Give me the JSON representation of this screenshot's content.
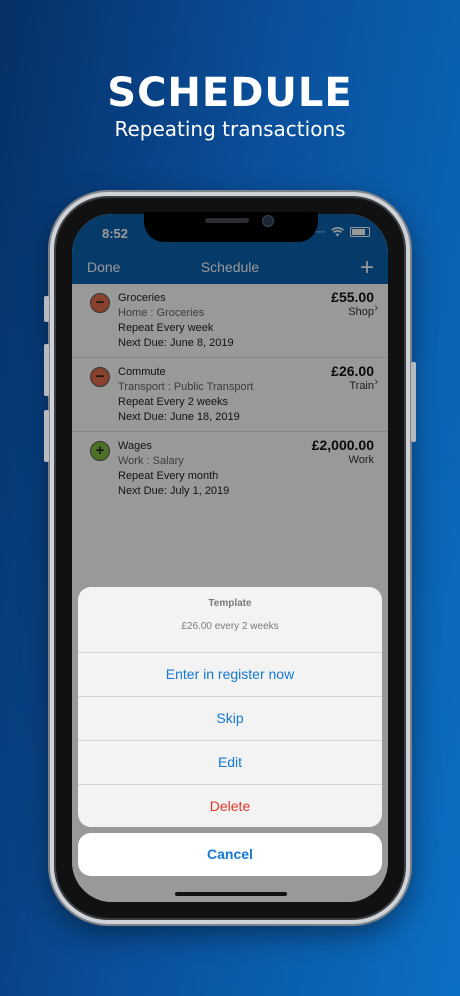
{
  "promo": {
    "title": "SCHEDULE",
    "subtitle": "Repeating transactions"
  },
  "status": {
    "time": "8:52"
  },
  "navbar": {
    "done_label": "Done",
    "title": "Schedule",
    "add_label": "+"
  },
  "transactions": [
    {
      "name": "Groceries",
      "category": "Home : Groceries",
      "repeat": "Repeat Every week",
      "next_due": "Next Due: June 8, 2019",
      "amount": "£55.00",
      "payee": "Shop",
      "type": "minus"
    },
    {
      "name": "Commute",
      "category": "Transport : Public Transport",
      "repeat": "Repeat Every 2 weeks",
      "next_due": "Next Due: June 18, 2019",
      "amount": "£26.00",
      "payee": "Train",
      "type": "minus"
    },
    {
      "name": "Wages",
      "category": "Work : Salary",
      "repeat": "Repeat Every month",
      "next_due": "Next Due: July 1, 2019",
      "amount": "£2,000.00",
      "payee": "Work",
      "type": "plus"
    }
  ],
  "action_sheet": {
    "title": "Template",
    "message": "£26.00 every 2 weeks",
    "actions": [
      "Enter in register now",
      "Skip",
      "Edit",
      "Delete"
    ],
    "cancel": "Cancel"
  },
  "colors": {
    "nav_bar": "#0b63b0",
    "action_blue": "#1478d4",
    "destructive_red": "#e0362b",
    "expense_icon": "#e26d4a",
    "income_icon": "#7fbd3c"
  }
}
